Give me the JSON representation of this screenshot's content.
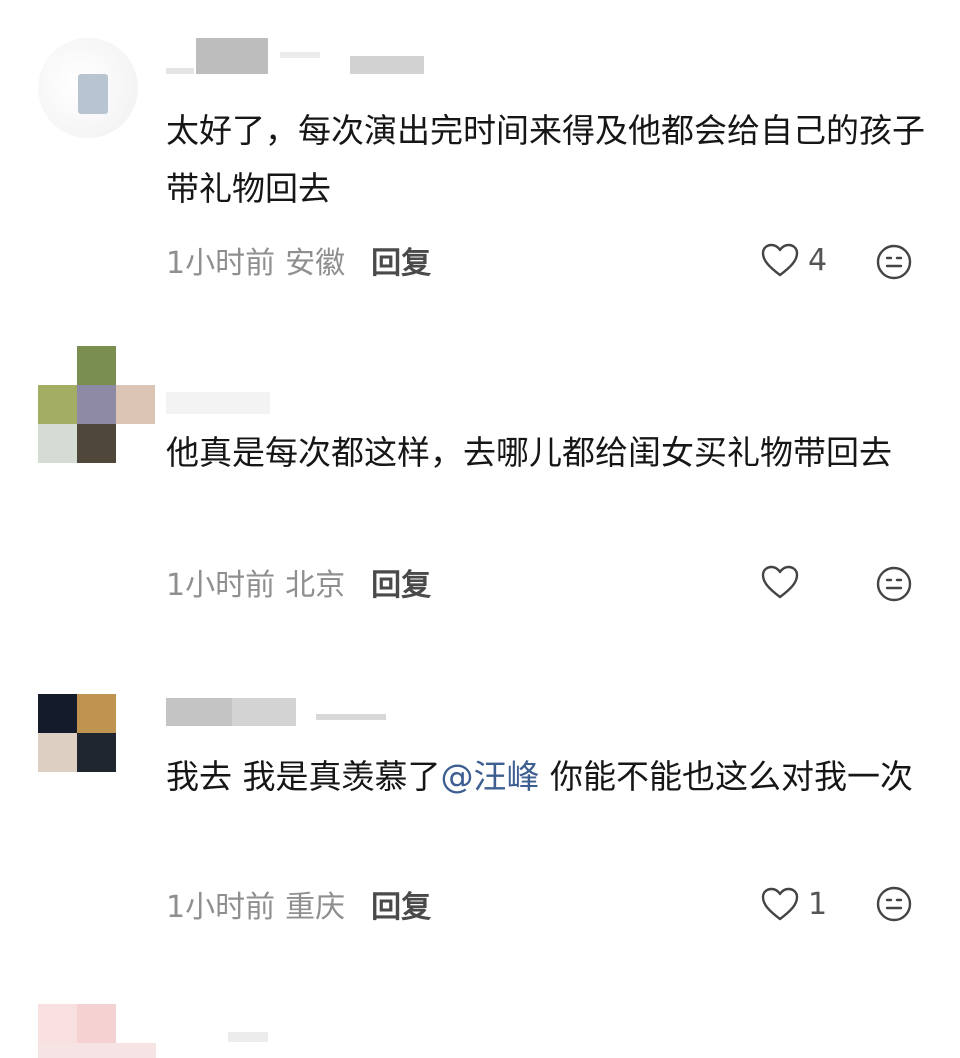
{
  "comments": [
    {
      "text": "太好了，每次演出完时间来得及他都会给自己的孩子带礼物回去",
      "time": "1小时前",
      "location": "安徽",
      "reply_label": "回复",
      "likes": "4"
    },
    {
      "text": "他真是每次都这样，去哪儿都给闺女买礼物带回去",
      "time": "1小时前",
      "location": "北京",
      "reply_label": "回复",
      "likes": ""
    },
    {
      "text_before": "我去 我是真羡慕了",
      "mention": "@汪峰",
      "text_after": " 你能不能也这么对我一次",
      "time": "1小时前",
      "location": "重庆",
      "reply_label": "回复",
      "likes": "1"
    }
  ],
  "icons": {
    "like": "heart-outline-icon",
    "emoji": "emoji-face-icon"
  },
  "colors": {
    "text": "#161616",
    "meta": "#8f8f8f",
    "mention": "#3d5e91"
  }
}
